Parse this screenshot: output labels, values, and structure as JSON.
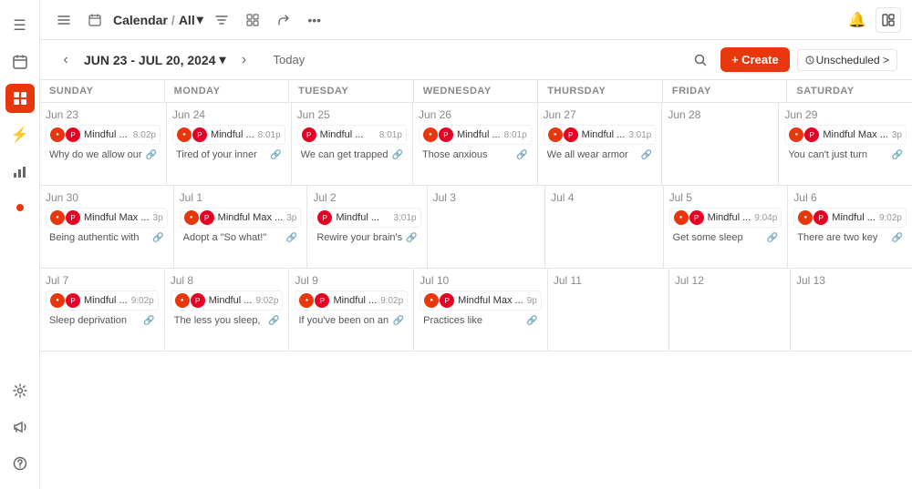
{
  "sidebar": {
    "icons": [
      "☰",
      "📅",
      "⚡",
      "📊",
      "🔴",
      "⚙",
      "📣",
      "❓"
    ]
  },
  "topbar": {
    "calendar_label": "Calendar",
    "separator": "/",
    "all_label": "All",
    "icons": [
      "filter",
      "grid",
      "share",
      "more"
    ]
  },
  "cal_toolbar": {
    "date_range": "JUN 23 - JUL 20, 2024",
    "today_label": "Today",
    "create_label": "+ Create",
    "unscheduled_label": "Unscheduled >"
  },
  "headers": [
    "SUNDAY",
    "MONDAY",
    "TUESDAY",
    "WEDNESDAY",
    "THURSDAY",
    "FRIDAY",
    "SATURDAY"
  ],
  "weeks": [
    {
      "days": [
        {
          "date": "Jun 23",
          "events": [
            {
              "icons": [
                "🔴",
                "P"
              ],
              "title": "Mindful ...",
              "time": "8:02p"
            }
          ],
          "notes": [
            {
              "text": "Why do we allow our"
            }
          ]
        },
        {
          "date": "Jun 24",
          "events": [
            {
              "icons": [
                "🔴",
                "P"
              ],
              "title": "Mindful ...",
              "time": "8:01p"
            }
          ],
          "notes": [
            {
              "text": "Tired of your inner"
            }
          ]
        },
        {
          "date": "Jun 25",
          "events": [
            {
              "icons": [
                "P"
              ],
              "title": "Mindful ...",
              "time": "8:01p"
            }
          ],
          "notes": [
            {
              "text": "We can get trapped"
            }
          ]
        },
        {
          "date": "Jun 26",
          "events": [
            {
              "icons": [
                "🔴",
                "P"
              ],
              "title": "Mindful ...",
              "time": "8:01p"
            }
          ],
          "notes": [
            {
              "text": "Those anxious"
            }
          ]
        },
        {
          "date": "Jun 27",
          "events": [
            {
              "icons": [
                "🔴",
                "P"
              ],
              "title": "Mindful ...",
              "time": "3:01p"
            }
          ],
          "notes": [
            {
              "text": "We all wear armor"
            }
          ]
        },
        {
          "date": "Jun 28",
          "events": [],
          "notes": []
        },
        {
          "date": "Jun 29",
          "events": [
            {
              "icons": [
                "🔴",
                "P"
              ],
              "title": "Mindful Max ...",
              "time": "3p"
            }
          ],
          "notes": [
            {
              "text": "You can't just turn"
            }
          ]
        }
      ]
    },
    {
      "days": [
        {
          "date": "Jun 30",
          "events": [
            {
              "icons": [
                "🔴",
                "P"
              ],
              "title": "Mindful Max ...",
              "time": "3p"
            }
          ],
          "notes": [
            {
              "text": "Being authentic with"
            }
          ]
        },
        {
          "date": "Jul 1",
          "events": [
            {
              "icons": [
                "🔴",
                "P"
              ],
              "title": "Mindful Max ...",
              "time": "3p"
            }
          ],
          "notes": [
            {
              "text": "Adopt a \"So what!\""
            }
          ]
        },
        {
          "date": "Jul 2",
          "events": [
            {
              "icons": [
                "P"
              ],
              "title": "Mindful ...",
              "time": "3:01p"
            }
          ],
          "notes": [
            {
              "text": "Rewire your brain's"
            }
          ]
        },
        {
          "date": "Jul 3",
          "events": [],
          "notes": []
        },
        {
          "date": "Jul 4",
          "events": [],
          "notes": []
        },
        {
          "date": "Jul 5",
          "events": [
            {
              "icons": [
                "🔴",
                "P"
              ],
              "title": "Mindful ...",
              "time": "9:04p"
            }
          ],
          "notes": [
            {
              "text": "Get some sleep"
            }
          ]
        },
        {
          "date": "Jul 6",
          "events": [
            {
              "icons": [
                "🔴",
                "P"
              ],
              "title": "Mindful ...",
              "time": "9:02p"
            }
          ],
          "notes": [
            {
              "text": "There are two key"
            }
          ]
        }
      ]
    },
    {
      "days": [
        {
          "date": "Jul 7",
          "events": [
            {
              "icons": [
                "🔴",
                "P"
              ],
              "title": "Mindful ...",
              "time": "9:02p"
            }
          ],
          "notes": [
            {
              "text": "Sleep deprivation"
            }
          ]
        },
        {
          "date": "Jul 8",
          "events": [
            {
              "icons": [
                "🔴",
                "P"
              ],
              "title": "Mindful ...",
              "time": "9:02p"
            }
          ],
          "notes": [
            {
              "text": "The less you sleep,"
            }
          ]
        },
        {
          "date": "Jul 9",
          "events": [
            {
              "icons": [
                "🔴",
                "P"
              ],
              "title": "Mindful ...",
              "time": "9:02p"
            }
          ],
          "notes": [
            {
              "text": "If you've been on an"
            }
          ]
        },
        {
          "date": "Jul 10",
          "events": [
            {
              "icons": [
                "🔴",
                "P"
              ],
              "title": "Mindful Max ...",
              "time": "9p"
            }
          ],
          "notes": [
            {
              "text": "Practices like"
            }
          ]
        },
        {
          "date": "Jul 11",
          "events": [],
          "notes": []
        },
        {
          "date": "Jul 12",
          "events": [],
          "notes": []
        },
        {
          "date": "Jul 13",
          "events": [],
          "notes": []
        }
      ]
    }
  ]
}
